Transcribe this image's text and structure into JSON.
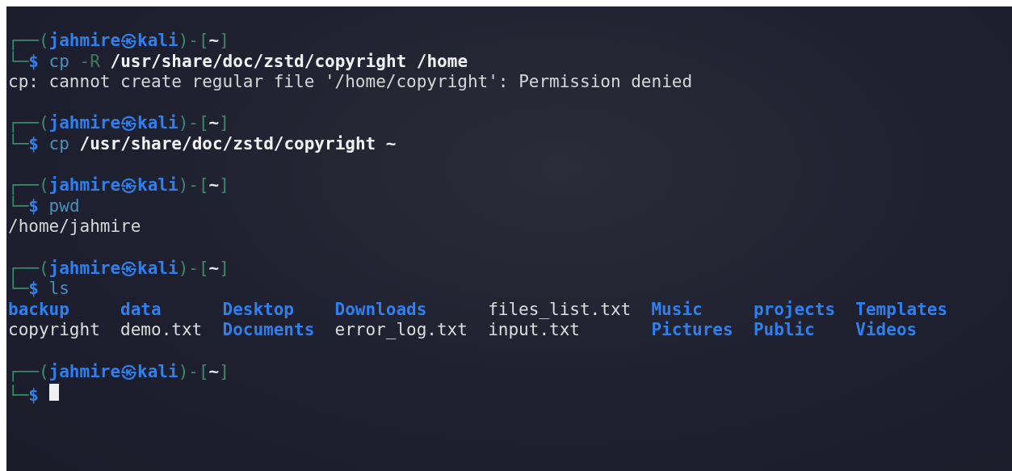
{
  "terminal": {
    "blocks": [
      {
        "prompt": {
          "frame_start": "┌──(",
          "user": "jahmire㉿kali",
          "frame_mid": ")-[",
          "dir": "~",
          "frame_end": "]",
          "corner": "└─",
          "symbol": "$"
        },
        "command": [
          {
            "text": "cp",
            "kind": "program"
          },
          {
            "text": "-R",
            "kind": "flag"
          },
          {
            "text": "/usr/share/doc/zstd/copyright /home",
            "kind": "argument"
          }
        ],
        "output": [
          "cp: cannot create regular file '/home/copyright': Permission denied"
        ]
      },
      {
        "prompt": {
          "frame_start": "┌──(",
          "user": "jahmire㉿kali",
          "frame_mid": ")-[",
          "dir": "~",
          "frame_end": "]",
          "corner": "└─",
          "symbol": "$"
        },
        "command": [
          {
            "text": "cp",
            "kind": "program"
          },
          {
            "text": "/usr/share/doc/zstd/copyright ~",
            "kind": "argument"
          }
        ]
      },
      {
        "prompt": {
          "frame_start": "┌──(",
          "user": "jahmire㉿kali",
          "frame_mid": ")-[",
          "dir": "~",
          "frame_end": "]",
          "corner": "└─",
          "symbol": "$"
        },
        "command": [
          {
            "text": "pwd",
            "kind": "program"
          }
        ],
        "output": [
          "/home/jahmire"
        ]
      },
      {
        "prompt": {
          "frame_start": "┌──(",
          "user": "jahmire㉿kali",
          "frame_mid": ")-[",
          "dir": "~",
          "frame_end": "]",
          "corner": "└─",
          "symbol": "$"
        },
        "command": [
          {
            "text": "ls",
            "kind": "program"
          }
        ],
        "listing": [
          [
            {
              "name": "backup",
              "kind": "dir"
            },
            {
              "name": "data",
              "kind": "dir"
            },
            {
              "name": "Desktop",
              "kind": "dir"
            },
            {
              "name": "Downloads",
              "kind": "dir"
            },
            {
              "name": "files_list.txt",
              "kind": "file"
            },
            {
              "name": "Music",
              "kind": "dir"
            },
            {
              "name": "projects",
              "kind": "dir"
            },
            {
              "name": "Templates",
              "kind": "dir"
            }
          ],
          [
            {
              "name": "copyright",
              "kind": "file"
            },
            {
              "name": "demo.txt",
              "kind": "file"
            },
            {
              "name": "Documents",
              "kind": "dir"
            },
            {
              "name": "error_log.txt",
              "kind": "file"
            },
            {
              "name": "input.txt",
              "kind": "file"
            },
            {
              "name": "Pictures",
              "kind": "dir"
            },
            {
              "name": "Public",
              "kind": "dir"
            },
            {
              "name": "Videos",
              "kind": "dir"
            }
          ]
        ]
      },
      {
        "prompt": {
          "frame_start": "┌──(",
          "user": "jahmire㉿kali",
          "frame_mid": ")-[",
          "dir": "~",
          "frame_end": "]",
          "corner": "└─",
          "symbol": "$"
        },
        "cursor": true
      }
    ]
  }
}
